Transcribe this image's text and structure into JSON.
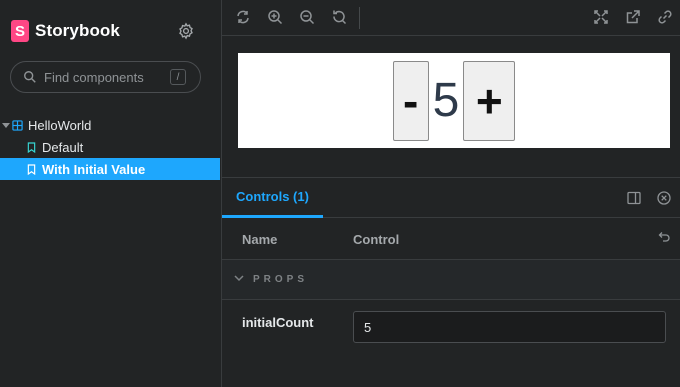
{
  "sidebar": {
    "brand": {
      "logo_letter": "S",
      "name": "Storybook"
    },
    "search": {
      "placeholder": "Find components",
      "shortcut": "/"
    },
    "tree": {
      "component": "HelloWorld",
      "stories": [
        {
          "label": "Default",
          "selected": false
        },
        {
          "label": "With Initial Value",
          "selected": true
        }
      ]
    }
  },
  "toolbar": {
    "icons": [
      "sync-icon",
      "zoom-in-icon",
      "zoom-out-icon",
      "zoom-reset-icon",
      "fullscreen-icon",
      "open-new-tab-icon",
      "copy-link-icon"
    ]
  },
  "canvas": {
    "decrement_label": "-",
    "value": "5",
    "increment_label": "+"
  },
  "panel": {
    "tab_label": "Controls (1)",
    "table": {
      "col_name": "Name",
      "col_control": "Control",
      "section_label": "PROPS",
      "rows": [
        {
          "name": "initialCount",
          "value": "5"
        }
      ]
    }
  },
  "colors": {
    "accent": "#1ea7fd",
    "brand": "#ff4785",
    "background": "#222425"
  }
}
